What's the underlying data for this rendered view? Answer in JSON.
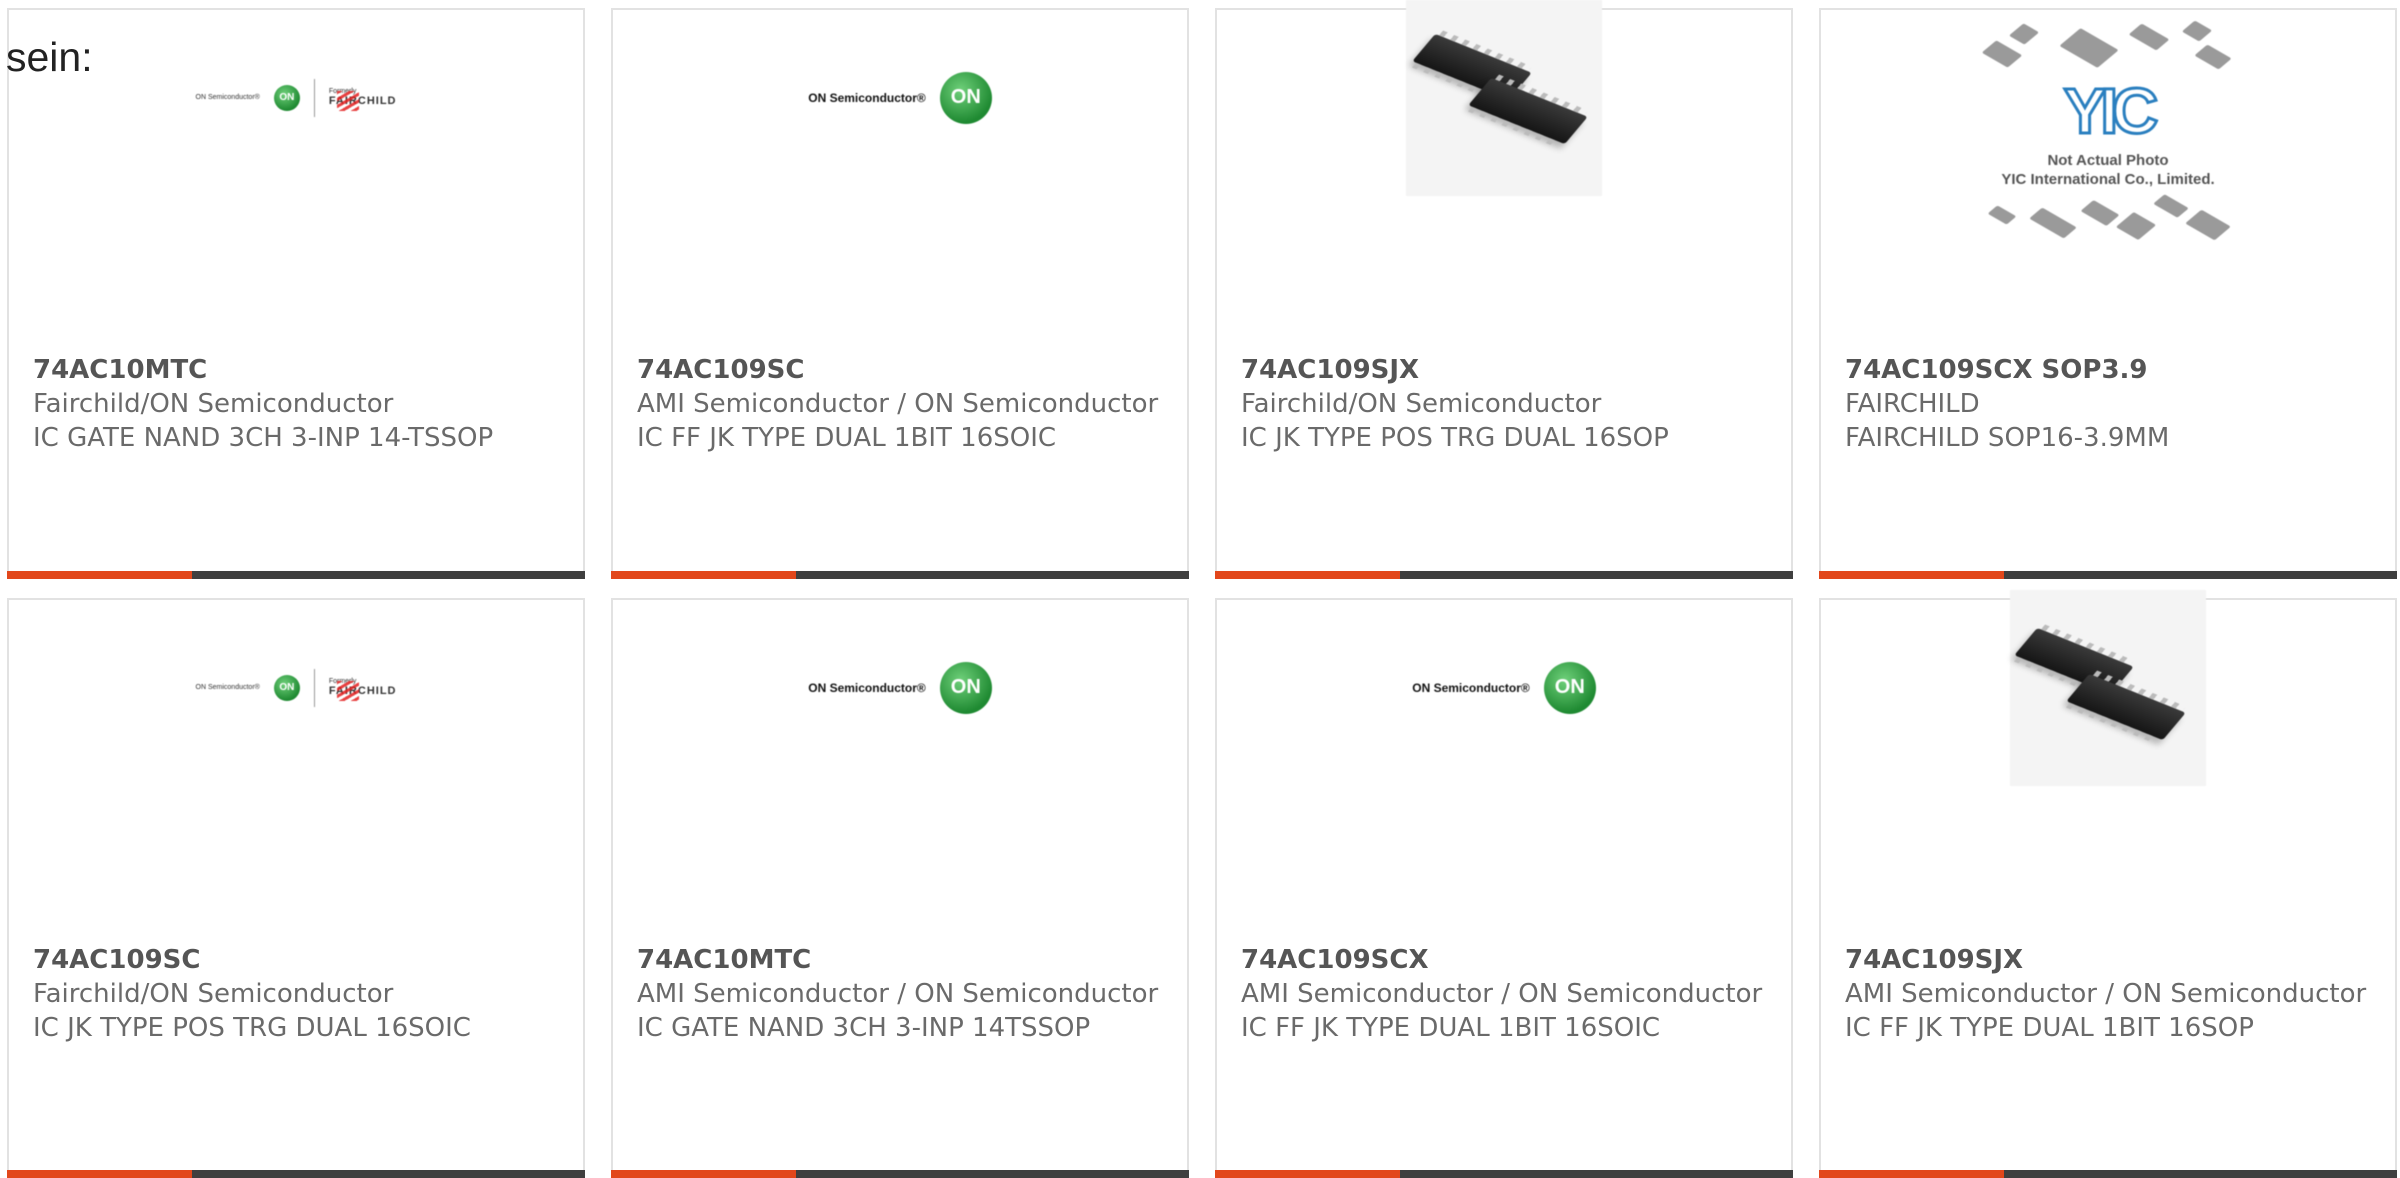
{
  "intro_text": "sein:",
  "products": [
    {
      "part": "74AC10MTC",
      "manufacturer": "Fairchild/ON Semiconductor",
      "description": "IC GATE NAND 3CH 3-INP 14-TSSOP",
      "image": "on-fairchild-logo"
    },
    {
      "part": "74AC109SC",
      "manufacturer": "AMI Semiconductor / ON Semiconductor",
      "description": "IC FF JK TYPE DUAL 1BIT 16SOIC",
      "image": "on-semiconductor-logo"
    },
    {
      "part": "74AC109SJX",
      "manufacturer": "Fairchild/ON Semiconductor",
      "description": "IC JK TYPE POS TRG DUAL 16SOP",
      "image": "soic-chip-photo"
    },
    {
      "part": "74AC109SCX SOP3.9",
      "manufacturer": "FAIRCHILD",
      "description": "FAIRCHILD SOP16-3.9MM",
      "image": "yic-placeholder",
      "image_text": {
        "logo": "YIC",
        "line1": "Not Actual Photo",
        "line2": "YIC International Co., Limited."
      }
    },
    {
      "part": "74AC109SC",
      "manufacturer": "Fairchild/ON Semiconductor",
      "description": "IC JK TYPE POS TRG DUAL 16SOIC",
      "image": "on-fairchild-logo"
    },
    {
      "part": "74AC10MTC",
      "manufacturer": "AMI Semiconductor / ON Semiconductor",
      "description": "IC GATE NAND 3CH 3-INP 14TSSOP",
      "image": "on-semiconductor-logo"
    },
    {
      "part": "74AC109SCX",
      "manufacturer": "AMI Semiconductor / ON Semiconductor",
      "description": "IC FF JK TYPE DUAL 1BIT 16SOIC",
      "image": "on-semiconductor-logo"
    },
    {
      "part": "74AC109SJX",
      "manufacturer": "AMI Semiconductor / ON Semiconductor",
      "description": "IC FF JK TYPE DUAL 1BIT 16SOP",
      "image": "soic-chip-photo"
    }
  ],
  "logo_text": {
    "on_semiconductor": "ON Semiconductor®",
    "on_badge": "ON",
    "formerly": "Formerly",
    "fairchild": "FAIRCHILD"
  },
  "colors": {
    "accent_orange": "#e2471b",
    "accent_dark": "#3f3f3f",
    "card_border": "#e2e2e2",
    "text_gray": "#6a6a6a"
  }
}
